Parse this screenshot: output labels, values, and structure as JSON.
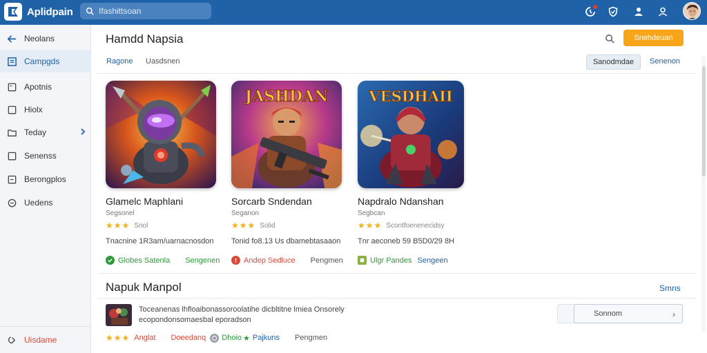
{
  "topbar": {
    "app_name": "Aplidpain",
    "search_placeholder": "Ifashittsoan"
  },
  "sidebar": {
    "items": [
      {
        "label": "Neolans"
      },
      {
        "label": "Campgds"
      },
      {
        "label": "Apotnis"
      },
      {
        "label": "Hiolx"
      },
      {
        "label": "Teday"
      },
      {
        "label": "Senenss"
      },
      {
        "label": "Berongplos"
      },
      {
        "label": "Uedens"
      }
    ],
    "footer_label": "Uisdame"
  },
  "main": {
    "title": "Hamdd Napsia",
    "primary_button": "Snehdeuan",
    "subnav": {
      "left_link_1": "Ragone",
      "left_link_2": "Uasdsnen",
      "right_button": "Sanodmdae",
      "right_link": "Senenon"
    }
  },
  "cards": [
    {
      "title": "Glamelc Maphlani",
      "subtitle": "Segsonel",
      "rating_text": "Snol",
      "stars": 3,
      "description": "Tnacnine 1R3am/uarnacnosdon",
      "meta_badge": "Globes Satenla",
      "meta_link": "Sengenen"
    },
    {
      "title": "Sorcarb Sndendan",
      "subtitle": "Seganon",
      "rating_text": "Solid",
      "stars": 3,
      "description": "Tonid fo8.13 Us dbamebtasaaon",
      "meta_badge": "Andep Sedluce",
      "meta_link": "Pengmen"
    },
    {
      "title": "Napdralo Ndanshan",
      "subtitle": "Segbcan",
      "rating_text": "Scontfoenenecidsy",
      "stars": 3,
      "description": "Tnr aeconeb 59 B5D0/29 8H",
      "meta_badge": "Ulgr Pandes",
      "meta_link": "Sengeen"
    }
  ],
  "section2": {
    "title": "Napuk Manpol",
    "see_all": "Smns",
    "item": {
      "description": "Toceanenas lhfloaibonassoroolatihe dicbltitne lmiea Onsorely ecopondonsomaesbal eporadson",
      "button_label": "Sonnom",
      "stars": 3,
      "meta_1": "Anglat",
      "meta_2": "Doeedanq",
      "meta_3": "Dhoio",
      "meta_4": "Pajkuns",
      "meta_5": "Pengmen"
    }
  },
  "colors": {
    "topbar": "#1f62a8",
    "accent_orange": "#f7a61c",
    "link_blue": "#1f62a8",
    "green": "#2e9a3a",
    "red": "#d84a3a"
  }
}
